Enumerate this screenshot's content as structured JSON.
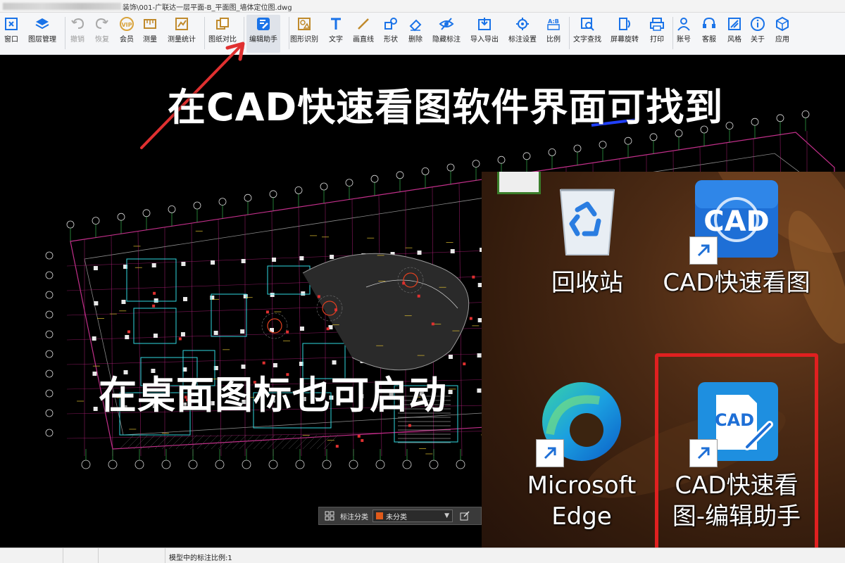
{
  "titlebar": {
    "title": "装饰\\001-广联达一层平面-B_平面图_墙体定位图.dwg"
  },
  "toolbar": {
    "items": [
      {
        "label": "窗口",
        "icon": "window-icon"
      },
      {
        "label": "图层管理",
        "icon": "layers-icon"
      },
      {
        "label": "撤销",
        "icon": "undo-icon",
        "disabled": true
      },
      {
        "label": "恢复",
        "icon": "redo-icon",
        "disabled": true
      },
      {
        "label": "会员",
        "icon": "vip-icon"
      },
      {
        "label": "测量",
        "icon": "measure-icon"
      },
      {
        "label": "测量统计",
        "icon": "measure-stats-icon"
      },
      {
        "label": "图纸对比",
        "icon": "compare-icon"
      },
      {
        "label": "编辑助手",
        "icon": "edit-assistant-icon",
        "active": true
      },
      {
        "label": "图形识别",
        "icon": "shape-recognize-icon"
      },
      {
        "label": "文字",
        "icon": "text-icon"
      },
      {
        "label": "画直线",
        "icon": "line-icon"
      },
      {
        "label": "形状",
        "icon": "shape-icon"
      },
      {
        "label": "删除",
        "icon": "eraser-icon"
      },
      {
        "label": "隐藏标注",
        "icon": "hide-annotation-icon"
      },
      {
        "label": "导入导出",
        "icon": "import-export-icon"
      },
      {
        "label": "标注设置",
        "icon": "annotation-settings-icon"
      },
      {
        "label": "比例",
        "icon": "scale-icon"
      },
      {
        "label": "文字查找",
        "icon": "text-search-icon"
      },
      {
        "label": "屏幕旋转",
        "icon": "rotate-screen-icon"
      },
      {
        "label": "打印",
        "icon": "print-icon"
      },
      {
        "label": "账号",
        "icon": "account-icon"
      },
      {
        "label": "客服",
        "icon": "support-icon"
      },
      {
        "label": "风格",
        "icon": "style-icon"
      },
      {
        "label": "关于",
        "icon": "about-icon"
      },
      {
        "label": "应用",
        "icon": "apps-icon"
      }
    ]
  },
  "captions": {
    "top": "在CAD快速看图软件界面可找到",
    "middle": "在桌面图标也可启动"
  },
  "annotation_bar": {
    "label": "标注分类",
    "selected": "未分类",
    "swatch_color": "#e05a1a"
  },
  "statusbar": {
    "scale_text": "模型中的标注比例:1"
  },
  "desktop": {
    "icons": [
      {
        "name": "回收站",
        "icon": "recycle-bin-icon"
      },
      {
        "name": "CAD快速看图",
        "icon": "cad-viewer-icon"
      },
      {
        "name": "Microsoft Edge",
        "icon": "edge-icon"
      },
      {
        "name": "CAD快速看图-编辑助手",
        "icon": "cad-edit-assistant-icon"
      }
    ],
    "cad_logo_text": "CAD",
    "highlight_color": "#e02020"
  },
  "colors": {
    "arrow": "#e03030",
    "toolbar_accent": "#1a73e8"
  }
}
